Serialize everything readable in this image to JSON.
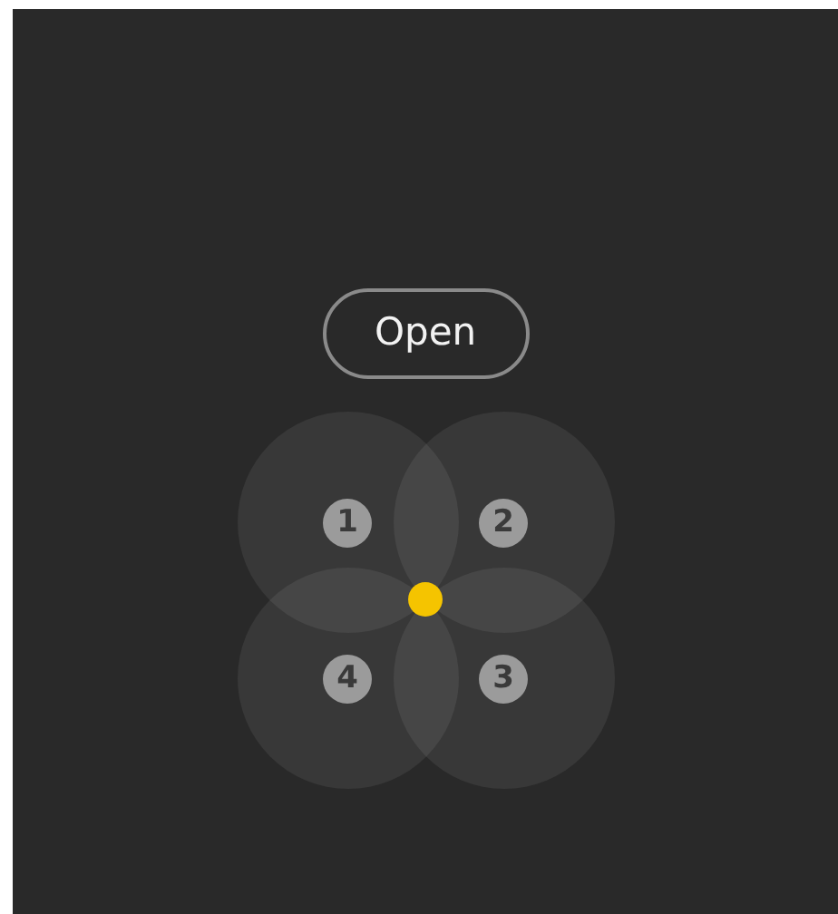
{
  "button": {
    "label": "Open"
  },
  "zones": [
    {
      "label": "1"
    },
    {
      "label": "2"
    },
    {
      "label": "4"
    },
    {
      "label": "3"
    }
  ]
}
